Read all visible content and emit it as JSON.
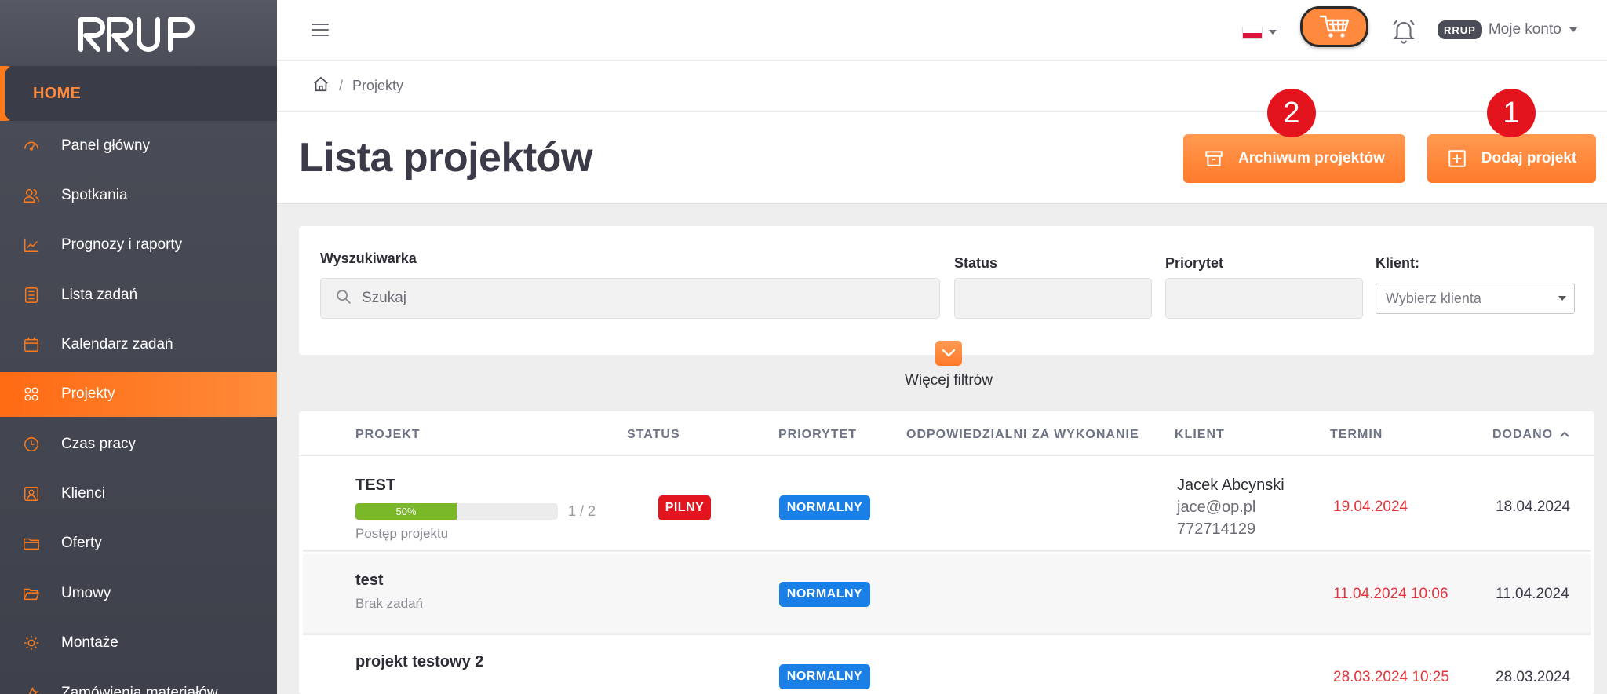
{
  "sidebar": {
    "home_label": "HOME",
    "items": [
      {
        "label": "Panel główny",
        "icon": "gauge-icon"
      },
      {
        "label": "Spotkania",
        "icon": "users-icon"
      },
      {
        "label": "Prognozy i raporty",
        "icon": "chart-line-icon"
      },
      {
        "label": "Lista zadań",
        "icon": "checklist-icon"
      },
      {
        "label": "Kalendarz zadań",
        "icon": "calendar-icon"
      },
      {
        "label": "Projekty",
        "icon": "grid-icon",
        "active": true
      },
      {
        "label": "Czas pracy",
        "icon": "clock-icon"
      },
      {
        "label": "Klienci",
        "icon": "contact-icon"
      },
      {
        "label": "Oferty",
        "icon": "folder-icon"
      },
      {
        "label": "Umowy",
        "icon": "folder-open-icon"
      },
      {
        "label": "Montaże",
        "icon": "sun-icon"
      },
      {
        "label": "Zamówienia materiałów",
        "icon": "wrench-icon"
      }
    ]
  },
  "topbar": {
    "account_logo": "RRUP",
    "account_label": "Moje konto"
  },
  "breadcrumb": {
    "current": "Projekty"
  },
  "header": {
    "title": "Lista projektów",
    "archive_button": "Archiwum projektów",
    "add_button": "Dodaj projekt",
    "badge_archive": "2",
    "badge_add": "1"
  },
  "filters": {
    "search_label": "Wyszukiwarka",
    "search_placeholder": "Szukaj",
    "status_label": "Status",
    "priority_label": "Priorytet",
    "client_label": "Klient:",
    "client_placeholder": "Wybierz klienta",
    "more_label": "Więcej filtrów"
  },
  "table": {
    "columns": [
      "PROJEKT",
      "STATUS",
      "PRIORYTET",
      "ODPOWIEDZIALNI ZA WYKONANIE",
      "KLIENT",
      "TERMIN",
      "DODANO"
    ],
    "rows": [
      {
        "name": "TEST",
        "progress_pct": "50%",
        "progress_count": "1 / 2",
        "sub": "Postęp projektu",
        "status": "PILNY",
        "priority": "NORMALNY",
        "client_name": "Jacek Abcynski",
        "client_email": "jace@op.pl",
        "client_phone": "772714129",
        "termin": "19.04.2024",
        "dodano": "18.04.2024"
      },
      {
        "name": "test",
        "sub": "Brak zadań",
        "priority": "NORMALNY",
        "termin": "11.04.2024 10:06",
        "dodano": "11.04.2024"
      },
      {
        "name": "projekt testowy 2",
        "priority": "NORMALNY",
        "termin": "28.03.2024 10:25",
        "dodano": "28.03.2024"
      }
    ]
  },
  "colors": {
    "accent": "#ff7a1a",
    "sidebar_bg": "#44474f",
    "danger": "#e3141e",
    "info": "#1a7fe6",
    "progress": "#7ab82a"
  }
}
